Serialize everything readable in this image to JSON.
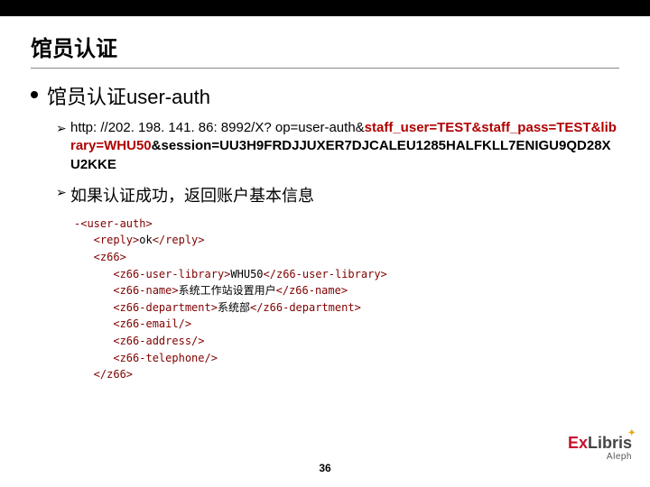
{
  "title": "馆员认证",
  "heading": "馆员认证user-auth",
  "url_prefix": "http: //202. 198. 141. 86: 8992/X? op=user-auth&",
  "url_red": "staff_user=TEST&staff_pass=TEST&library=WHU50",
  "url_suffix": "&session=UU3H9FRDJJUXER7DJCALEU1285HALFKLL7ENIGU9QD28XU2KKE",
  "success_text": "如果认证成功，返回账户基本信息",
  "xml": {
    "l1": "-<user-auth>",
    "l2": "   <reply>",
    "l2v": "ok",
    "l2c": "</reply>",
    "l3": "   <z66>",
    "l4": "      <z66-user-library>",
    "l4v": "WHU50",
    "l4c": "</z66-user-library>",
    "l5": "      <z66-name>",
    "l5v": "系统工作站设置用户",
    "l5c": "</z66-name>",
    "l6": "      <z66-department>",
    "l6v": "系统部",
    "l6c": "</z66-department>",
    "l7": "      <z66-email/>",
    "l8": "      <z66-address/>",
    "l9": "      <z66-telephone/>",
    "l10": "   </z66>"
  },
  "page_number": "36",
  "logo": {
    "ex": "Ex",
    "libris": "Libris",
    "aleph": "Aleph"
  }
}
